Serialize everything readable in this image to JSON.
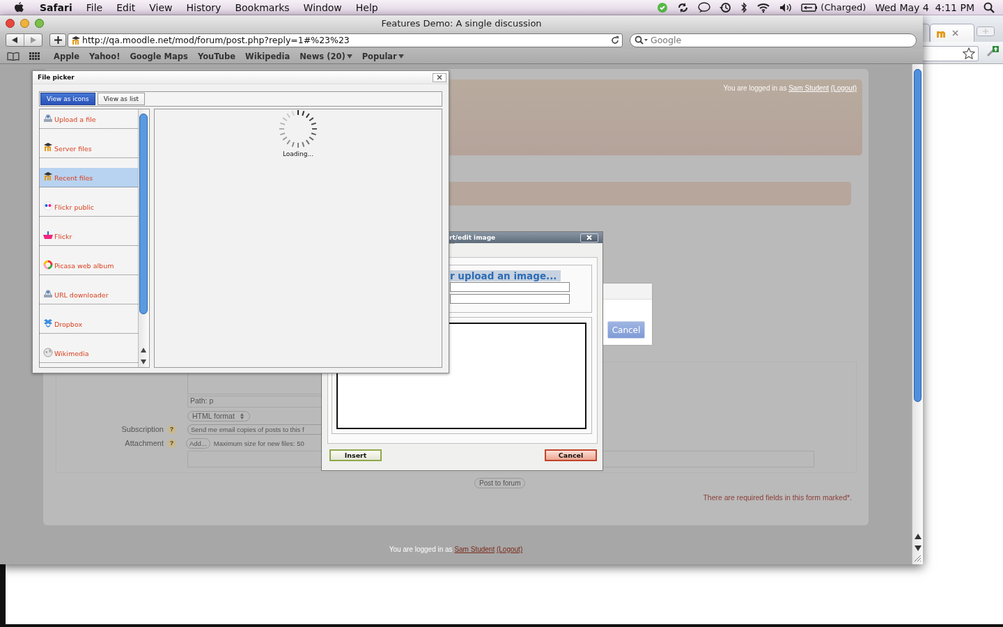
{
  "menu_bar": {
    "app": "Safari",
    "items": [
      "File",
      "Edit",
      "View",
      "History",
      "Bookmarks",
      "Window",
      "Help"
    ],
    "battery": "(Charged)",
    "clock": "Wed May 4  4:11 PM"
  },
  "browser": {
    "title": "Features Demo: A single discussion",
    "url": "http://qa.moodle.net/mod/forum/post.php?reply=1#%23%23",
    "search_placeholder": "Google",
    "bookmarks": [
      {
        "label": "Apple",
        "menu": false
      },
      {
        "label": "Yahoo!",
        "menu": false
      },
      {
        "label": "Google Maps",
        "menu": false
      },
      {
        "label": "YouTube",
        "menu": false
      },
      {
        "label": "Wikipedia",
        "menu": false
      },
      {
        "label": "News (20)",
        "menu": true
      },
      {
        "label": "Popular",
        "menu": true
      }
    ]
  },
  "page": {
    "header_login": {
      "prefix": "You are logged in as",
      "user": "Sam Student",
      "logout": "(Logout)"
    },
    "path": "Path: p",
    "format": "HTML format",
    "subscription": {
      "label": "Subscription",
      "help": "?",
      "value": "Send me email copies of posts to this f"
    },
    "attachment": {
      "label": "Attachment",
      "help": "?",
      "button": "Add...",
      "note": "Maximum size for new files: 50"
    },
    "post_button": "Post to forum",
    "required_note": "There are required fields in this form marked*.",
    "footer_login": {
      "prefix": "You are logged in as",
      "user": "Sam Student",
      "logout": "(Logout)"
    }
  },
  "file_picker": {
    "title": "File picker",
    "views": [
      {
        "label": "View as icons",
        "selected": true
      },
      {
        "label": "View as list",
        "selected": false
      }
    ],
    "repositories": [
      {
        "label": "Upload a file",
        "kind": "upload",
        "selected": false
      },
      {
        "label": "Server files",
        "kind": "moodle",
        "selected": false
      },
      {
        "label": "Recent files",
        "kind": "moodle",
        "selected": true
      },
      {
        "label": "Flickr public",
        "kind": "dots",
        "selected": false
      },
      {
        "label": "Flickr",
        "kind": "basket",
        "selected": false
      },
      {
        "label": "Picasa web album",
        "kind": "ring",
        "selected": false
      },
      {
        "label": "URL downloader",
        "kind": "upload",
        "selected": false
      },
      {
        "label": "Dropbox",
        "kind": "box",
        "selected": false
      },
      {
        "label": "Wikimedia",
        "kind": "globe",
        "selected": false
      }
    ],
    "loading": "Loading..."
  },
  "image_dialog": {
    "title": "rt/edit image",
    "heading": "r upload an image...",
    "insert": "Insert",
    "cancel": "Cancel"
  },
  "back_dialog": {
    "cancel": "Cancel"
  }
}
